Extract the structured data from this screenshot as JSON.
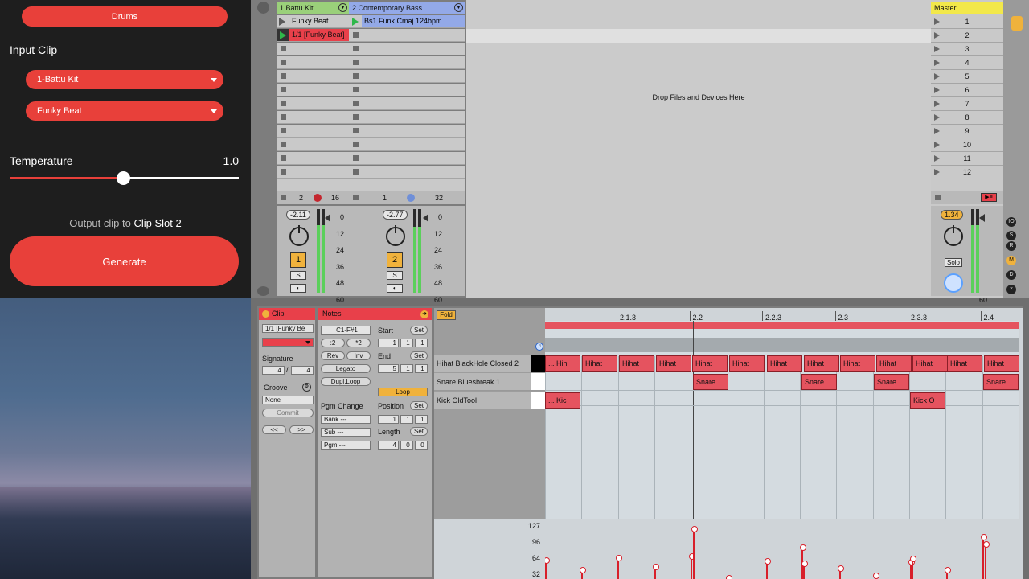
{
  "plugin": {
    "drums_label": "Drums",
    "input_clip_heading": "Input Clip",
    "track_selected": "1-Battu Kit",
    "clip_selected": "Funky Beat",
    "temperature_label": "Temperature",
    "temperature_value": "1.0",
    "temperature_fraction": 0.5,
    "output_prefix": "Output clip to",
    "output_target": "Clip Slot 2",
    "generate_label": "Generate"
  },
  "session": {
    "tracks": [
      {
        "name": "1 Battu Kit",
        "header_color": "#9ad07a",
        "clips": [
          "Funky Beat",
          "1/1 [Funky Beat]"
        ],
        "footer_left": "2",
        "footer_right": "16",
        "volume": "-2.11",
        "number": "1",
        "solo": "S"
      },
      {
        "name": "2 Contemporary Bass",
        "header_color": "#93a9e8",
        "clips": [
          "Bs1 Funk Cmaj 124bpm"
        ],
        "footer_left": "1",
        "footer_right": "32",
        "volume": "-2.77",
        "number": "2",
        "solo": "S"
      }
    ],
    "drop_text": "Drop Files and Devices Here",
    "master": {
      "name": "Master",
      "scenes": [
        "1",
        "2",
        "3",
        "4",
        "5",
        "6",
        "7",
        "8",
        "9",
        "10",
        "11",
        "12"
      ],
      "volume": "1.34",
      "solo": "Solo"
    },
    "meter_scale": [
      "0",
      "12",
      "24",
      "36",
      "48",
      "60"
    ]
  },
  "detail": {
    "clip_header": "Clip",
    "clip_name": "1/1 [Funky Be",
    "signature_label": "Signature",
    "sig_num": "4",
    "sig_den": "4",
    "sig_sep": "/",
    "groove_label": "Groove",
    "groove_value": "None",
    "commit_label": "Commit",
    "prev_label": "<<",
    "next_label": ">>",
    "notes_header": "Notes",
    "range": "C1-F#1",
    "div2": ":2",
    "mul2": "*2",
    "rev": "Rev",
    "inv": "Inv",
    "legato": "Legato",
    "dupl": "Dupl.Loop",
    "pgm_change": "Pgm Change",
    "bank": "Bank ---",
    "sub": "Sub ---",
    "pgm": "Pgm ---",
    "start_label": "Start",
    "end_label": "End",
    "set_label": "Set",
    "loop_label": "Loop",
    "position_label": "Position",
    "length_label": "Length",
    "start_vals": [
      "1",
      "1",
      "1"
    ],
    "end_vals": [
      "5",
      "1",
      "1"
    ],
    "position_vals": [
      "1",
      "1",
      "1"
    ],
    "length_vals": [
      "4",
      "0",
      "0"
    ],
    "fold_label": "Fold",
    "ruler": [
      "2.1.3",
      "2.2",
      "2.2.3",
      "2.3",
      "2.3.3",
      "2.4"
    ],
    "lanes": [
      "Hihat BlackHole Closed 2",
      "Snare Bluesbreak 1",
      "Kick OldTool"
    ],
    "velocity_labels": [
      "127",
      "96",
      "64",
      "32"
    ]
  },
  "colors": {
    "accent": "#e8403a",
    "clip_red": "#e5535f",
    "battu_green": "#9ad07a",
    "bass_blue": "#93a9e8",
    "master_yellow": "#f2e84a"
  }
}
